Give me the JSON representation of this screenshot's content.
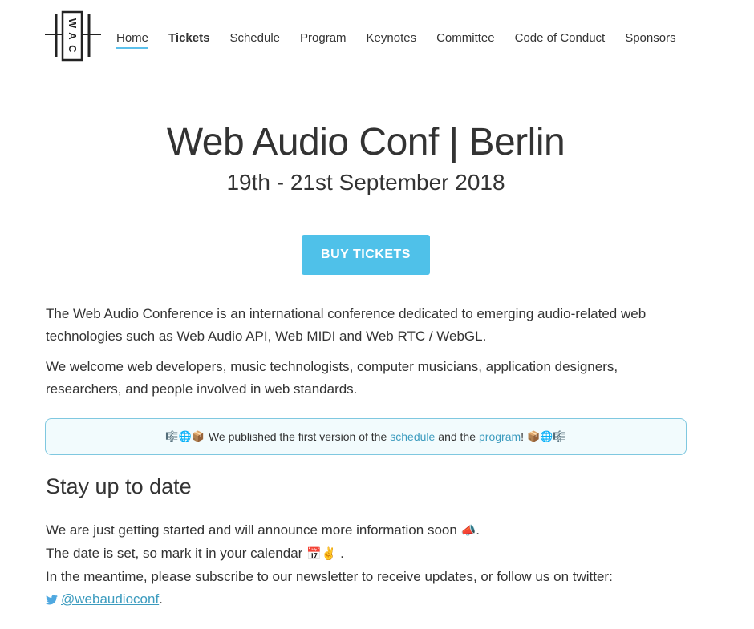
{
  "logo": {
    "text": "WAC",
    "icon": "wac-logo-icon"
  },
  "nav": {
    "items": [
      {
        "label": "Home"
      },
      {
        "label": "Tickets"
      },
      {
        "label": "Schedule"
      },
      {
        "label": "Program"
      },
      {
        "label": "Keynotes"
      },
      {
        "label": "Committee"
      },
      {
        "label": "Code of Conduct"
      },
      {
        "label": "Sponsors"
      }
    ]
  },
  "hero": {
    "title": "Web Audio Conf | Berlin",
    "date": "19th - 21st September 2018",
    "button": "BUY TICKETS"
  },
  "intro": {
    "p1": "The Web Audio Conference is an international conference dedicated to emerging audio-related web technologies such as Web Audio API, Web MIDI and Web RTC / WebGL.",
    "p2": "We welcome web developers, music technologists, computer musicians, application designers, researchers, and people involved in web standards."
  },
  "notice": {
    "emoji_left": "🎼🌐📦",
    "text_before": "We published the first version of the",
    "link_schedule": "schedule",
    "text_middle": "and the",
    "link_program": "program",
    "text_after": "!",
    "emoji_right": "📦🌐🎼"
  },
  "stay": {
    "title": "Stay up to date",
    "line1": "We are just getting started and will announce more information soon",
    "line1_emoji": "📣",
    "line2": "The date is set, so mark it in your calendar",
    "line2_emoji": "📅✌️",
    "line3": "In the meantime, please subscribe to our newsletter to receive updates, or follow us on twitter:",
    "twitter_handle": "@webaudioconf",
    "twitter_icon": "twitter-bird-icon"
  },
  "colors": {
    "accent": "#4fc1e9",
    "link": "#3d9cbf",
    "notice_border": "#7fc8e0"
  }
}
